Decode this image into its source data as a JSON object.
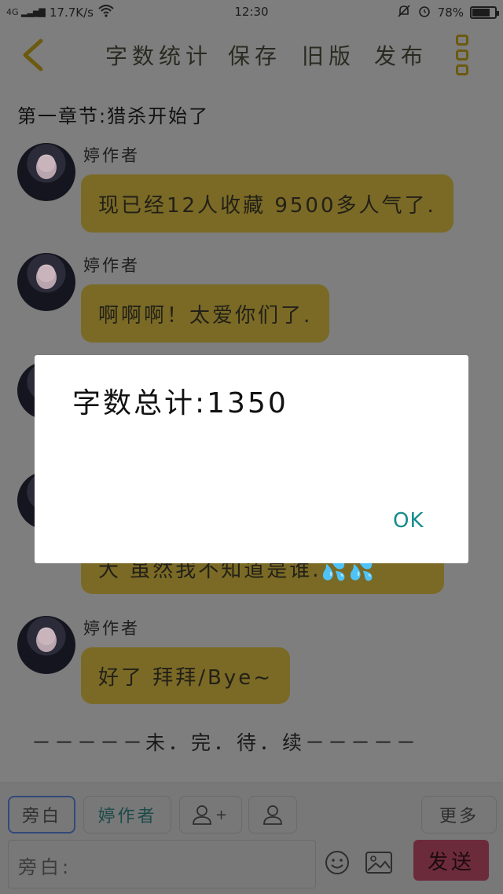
{
  "status_bar": {
    "network": "4G",
    "speed": "17.7K/s",
    "time": "12:30",
    "battery_text": "78%",
    "battery_level": 0.78
  },
  "nav": {
    "word_count": "字数统计",
    "save": "保存",
    "old_version": "旧版",
    "publish": "发布"
  },
  "chapter_title": "第一章节:猎杀开始了",
  "messages": [
    {
      "author": "婷作者",
      "text": "现已经12人收藏 9500多人气了."
    },
    {
      "author": "婷作者",
      "text": "啊啊啊！太爱你们了."
    },
    {
      "author": "",
      "text": ""
    },
    {
      "author": "",
      "text": "大 虽然我不知道是谁.💦💦"
    },
    {
      "author": "婷作者",
      "text": "好了 拜拜/Bye~"
    }
  ],
  "to_be_continued": "－－－－－未．完．待．续－－－－－",
  "bottom_bar": {
    "chip_narration": "旁白",
    "chip_author": "婷作者",
    "chip_add_suffix": "+",
    "more": "更多",
    "input_placeholder": "旁白:",
    "send": "发送"
  },
  "dialog": {
    "message": "字数总计:1350",
    "ok": "OK"
  },
  "colors": {
    "bubble": "#7a6a25",
    "ok_accent": "#168c8c",
    "send_bg": "#6c2b3b"
  }
}
